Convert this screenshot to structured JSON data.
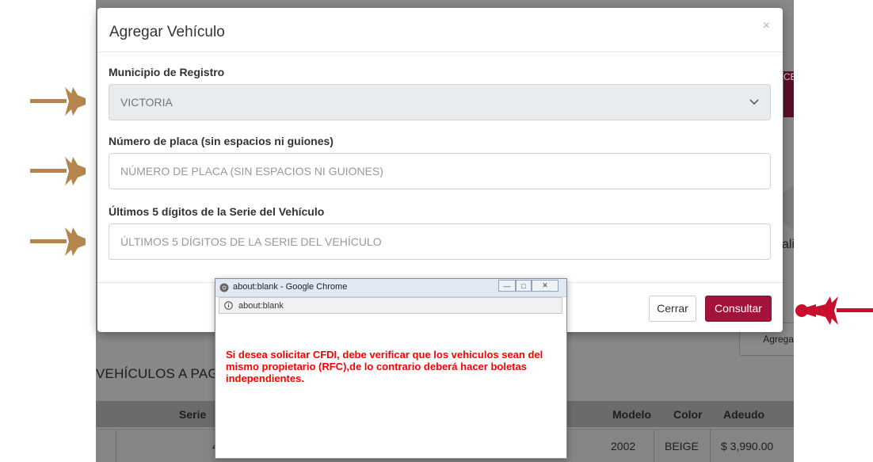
{
  "background": {
    "edge_button_text": "CE",
    "edge_text": "ali",
    "agregar_button": "Agregar",
    "section_title": "VEHÍCULOS A PAGAR:",
    "table": {
      "headers": [
        "Serie",
        "Modelo",
        "Color",
        "Adeudo"
      ],
      "row": {
        "serie_partial": "4",
        "modelo": "2002",
        "color": "BEIGE",
        "adeudo": "$ 3,990.00"
      }
    }
  },
  "modal": {
    "title": "Agregar Vehículo",
    "close_glyph": "×",
    "municipio": {
      "label": "Municipio de Registro",
      "value": "VICTORIA"
    },
    "placa": {
      "label": "Número de placa (sin espacios ni guiones)",
      "placeholder": "NÚMERO DE PLACA (SIN ESPACIOS NI GUIONES)"
    },
    "serie": {
      "label": "Últimos 5 dígitos de la Serie del Vehículo",
      "placeholder": "ÚLTIMOS 5 DÍGITOS DE LA SERIE DEL VEHÍCULO"
    },
    "buttons": {
      "cerrar": "Cerrar",
      "consultar": "Consultar"
    }
  },
  "popup": {
    "window_title": "about:blank - Google Chrome",
    "url": "about:blank",
    "message": "Si desea solicitar CFDI, debe verificar que los vehiculos sean del mismo propietario (RFC),de lo contrario deberá hacer boletas independientes."
  },
  "colors": {
    "brand": "#a3123a",
    "arrow_gold": "#b5854e",
    "arrow_red": "#c8102e",
    "popup_text": "#ff0000"
  },
  "icons": {
    "left_arrows": "gold-arrow-icon",
    "right_arrow": "red-arrow-icon",
    "chevron": "chevron-down-icon",
    "info": "info-icon",
    "favicon": "chrome-icon"
  }
}
